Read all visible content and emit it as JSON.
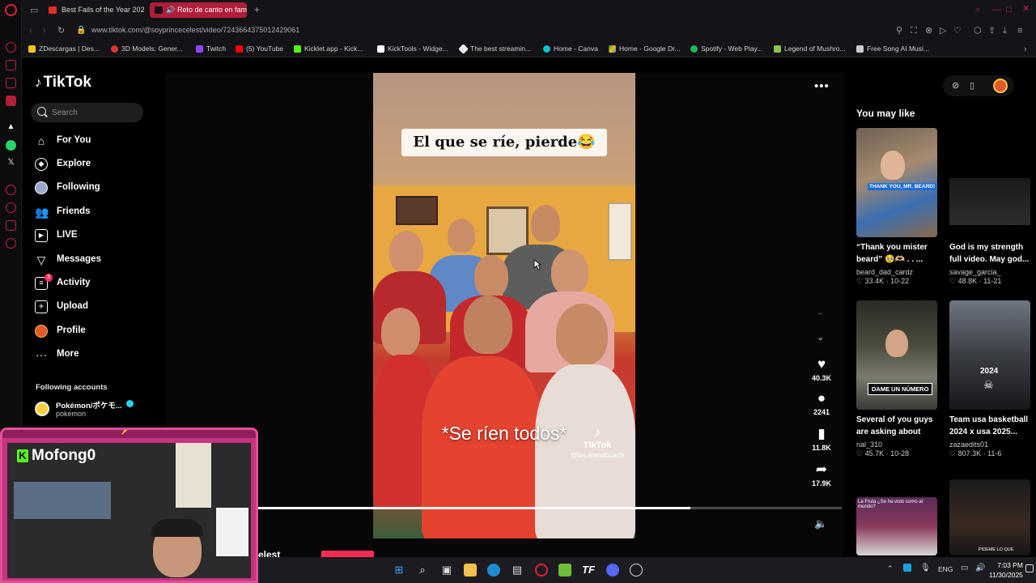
{
  "browser": {
    "tabs": [
      {
        "label": "Best Fails of the Year 202",
        "active": false
      },
      {
        "label": "Reto de canto en fami",
        "active": true
      }
    ],
    "new_tab_label": "+",
    "url": "www.tiktok.com/@soyprincecelest/video/7243664375012429061",
    "bookmarks": [
      "ZDescargas | Des...",
      "3D Models: Gener...",
      "Twitch",
      "(5) YouTube",
      "Kicklet.app - Kick...",
      "KickTools - Widge...",
      "The best streamin...",
      "Home - Canva",
      "Home - Google Dr...",
      "Spotify - Web Play...",
      "Legend of Mushro...",
      "Free Song AI Musi..."
    ]
  },
  "tiktok": {
    "logo_text": "TikTok",
    "search_placeholder": "Search",
    "nav": [
      {
        "label": "For You",
        "icon": "home-icon"
      },
      {
        "label": "Explore",
        "icon": "compass-icon"
      },
      {
        "label": "Following",
        "icon": "following-avatar-icon"
      },
      {
        "label": "Friends",
        "icon": "friends-icon"
      },
      {
        "label": "LIVE",
        "icon": "live-icon"
      },
      {
        "label": "Messages",
        "icon": "messages-icon"
      },
      {
        "label": "Activity",
        "icon": "activity-icon",
        "badge": "3"
      },
      {
        "label": "Upload",
        "icon": "upload-icon"
      },
      {
        "label": "Profile",
        "icon": "profile-avatar-icon"
      },
      {
        "label": "More",
        "icon": "more-dots-icon"
      }
    ],
    "following_header": "Following accounts",
    "following_accounts": [
      {
        "name": "Pokémon/ポケモ...",
        "handle": "pokemon",
        "verified": true
      }
    ]
  },
  "video": {
    "caption_text": "El que se ríe, pierde😂",
    "subtitle_text": "*Se ríen todos*",
    "watermark": "TikTok",
    "watermark_handle": "@les.mendoza09",
    "progress_fraction": 0.74,
    "likes": "40.3K",
    "comments": "2241",
    "saves": "11.8K",
    "shares": "17.9K",
    "below_title": "elest"
  },
  "right_panel": {
    "heading": "You may like",
    "cards": [
      {
        "title": "“Thank you mister beard” 🥹🫶🏼 . . ...",
        "user": "beard_dad_cardz",
        "stats": "♡ 33.4K · 10-22",
        "thumb_text": "THANK YOU, MR. BEARD!"
      },
      {
        "title": "God is my strength full video. May god...",
        "user": "savage_garcia_",
        "stats": "♡ 48.8K · 11-21",
        "thumb_text": ""
      },
      {
        "title": "Several of you guys are asking about th...",
        "user": "nal_310",
        "stats": "♡ 45.7K · 10-28",
        "thumb_text": "DAME UN NÚMERO"
      },
      {
        "title": "Team usa basketball 2024 x usa 2025...",
        "user": "zazaedits01",
        "stats": "♡ 807.3K · 11-6",
        "thumb_text": "2024"
      },
      {
        "title": "",
        "user": "",
        "stats": "",
        "thumb_text": "La Fruta ¿Se ha visto como al mundo?"
      },
      {
        "title": "",
        "user": "",
        "stats": "",
        "thumb_text": "PIDEME LO QUE"
      }
    ]
  },
  "stream_overlay": {
    "name": "Mofong0",
    "platform_logo": "K"
  },
  "taskbar": {
    "language": "ENG",
    "time": "7:03 PM",
    "date": "11/30/2025"
  },
  "colors": {
    "accent": "#fe2c55",
    "tab_active": "#b01e3a",
    "overlay_pink": "#c8337f",
    "kick_green": "#53fc18"
  }
}
